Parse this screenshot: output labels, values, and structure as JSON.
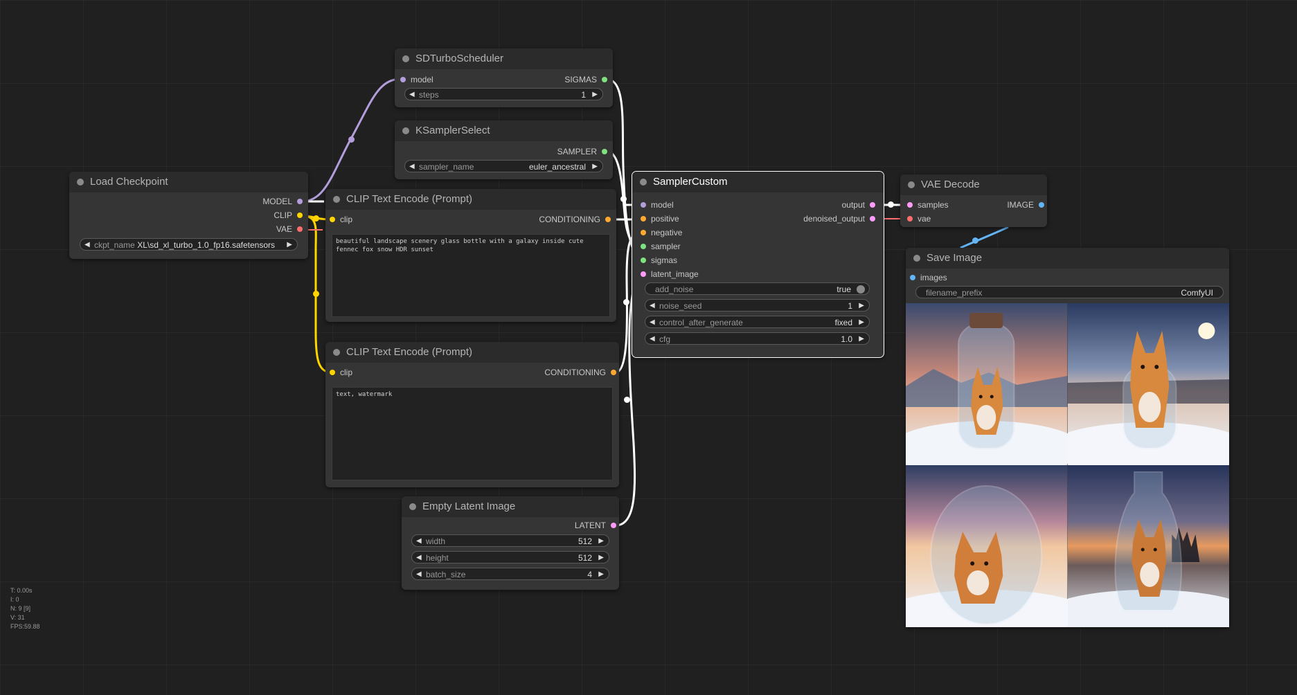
{
  "colors": {
    "model": "#b39ddb",
    "clip": "#ffd500",
    "vae": "#ff6e6e",
    "conditioning": "#ffa931",
    "latent": "#ff9cf9",
    "sigmas": "#7fe27f",
    "sampler": "#7fe27f",
    "image": "#64b5f6",
    "wire_white": "#ffffff"
  },
  "nodes": {
    "sd_turbo_scheduler": {
      "title": "SDTurboScheduler",
      "inputs": [
        "model"
      ],
      "outputs": [
        "SIGMAS"
      ],
      "widgets": [
        {
          "label": "steps",
          "value": "1"
        }
      ]
    },
    "ksampler_select": {
      "title": "KSamplerSelect",
      "outputs": [
        "SAMPLER"
      ],
      "widgets": [
        {
          "label": "sampler_name",
          "value": "euler_ancestral"
        }
      ]
    },
    "load_checkpoint": {
      "title": "Load Checkpoint",
      "outputs": [
        "MODEL",
        "CLIP",
        "VAE"
      ],
      "widgets": [
        {
          "label": "ckpt_name",
          "value": "XL\\sd_xl_turbo_1.0_fp16.safetensors"
        }
      ]
    },
    "clip_text_encode_positive": {
      "title": "CLIP Text Encode (Prompt)",
      "inputs": [
        "clip"
      ],
      "outputs": [
        "CONDITIONING"
      ],
      "text": "beautiful landscape scenery glass bottle with a galaxy inside cute fennec fox snow HDR sunset"
    },
    "clip_text_encode_negative": {
      "title": "CLIP Text Encode (Prompt)",
      "inputs": [
        "clip"
      ],
      "outputs": [
        "CONDITIONING"
      ],
      "text": "text, watermark"
    },
    "empty_latent_image": {
      "title": "Empty Latent Image",
      "outputs": [
        "LATENT"
      ],
      "widgets": [
        {
          "label": "width",
          "value": "512"
        },
        {
          "label": "height",
          "value": "512"
        },
        {
          "label": "batch_size",
          "value": "4"
        }
      ]
    },
    "sampler_custom": {
      "title": "SamplerCustom",
      "inputs": [
        "model",
        "positive",
        "negative",
        "sampler",
        "sigmas",
        "latent_image"
      ],
      "outputs": [
        "output",
        "denoised_output"
      ],
      "toggle": {
        "label": "add_noise",
        "value": "true"
      },
      "widgets": [
        {
          "label": "noise_seed",
          "value": "1"
        },
        {
          "label": "control_after_generate",
          "value": "fixed"
        },
        {
          "label": "cfg",
          "value": "1.0"
        }
      ]
    },
    "vae_decode": {
      "title": "VAE Decode",
      "inputs": [
        "samples",
        "vae"
      ],
      "outputs": [
        "IMAGE"
      ]
    },
    "save_image": {
      "title": "Save Image",
      "inputs": [
        "images"
      ],
      "widgets": [
        {
          "label": "filename_prefix",
          "value": "ComfyUI"
        }
      ],
      "preview_count": 4
    }
  },
  "stats": [
    "T: 0.00s",
    "I: 0",
    "N: 9 [9]",
    "V: 31",
    "FPS:59.88"
  ]
}
